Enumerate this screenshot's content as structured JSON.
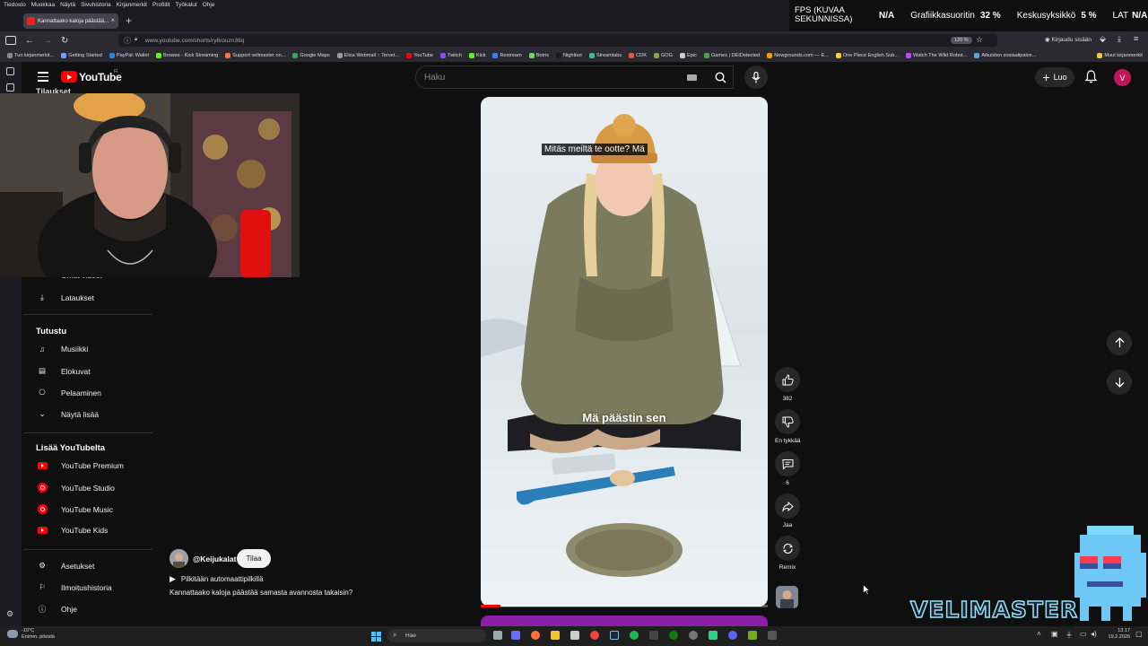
{
  "browser": {
    "menu": [
      "Tiedosto",
      "Muokkaa",
      "Näytä",
      "Sivuhistoria",
      "Kirjanmerkit",
      "Profiilit",
      "Työkalut",
      "Ohje"
    ],
    "tab_title": "Kannattaako kaloja päästää...",
    "url": "www.youtube.com/shorts/ry6rouzn36q",
    "zoom": "120 %",
    "signin": "Kirjaudu sisään",
    "bookmarks": [
      "Tuo kirjanmerkit...",
      "Getting Started",
      "PayPal: Wallet",
      "Browse - Kick Streaming",
      "Support velimaster on...",
      "Google Maps",
      "Elisa Webmail :: Tervet...",
      "YouTube",
      "Twitch",
      "Kick",
      "Restream",
      "Botrix",
      "Nightbot",
      "Streamlabs",
      "CDK",
      "GOG",
      "Epic",
      "Games | DEIDetected",
      "Newgrounds.com — E...",
      "One Piece English Sub...",
      "Watch The Wild Robot...",
      "Aikuisten sosiaalipalve...",
      "Muut kirjanmerkit"
    ]
  },
  "perf": {
    "fps_label": "FPS (KUVAA SEKUNNISSA)",
    "fps_value": "N/A",
    "gpu_label": "Grafiikkasuoritin",
    "gpu_value": "32 %",
    "cpu_label": "Keskusyksikkö",
    "cpu_value": "5 %",
    "lat_label": "LAT",
    "lat_value": "N/A"
  },
  "header": {
    "logo_text": "YouTube",
    "country": "FI",
    "search_placeholder": "Haku",
    "create_label": "Luo",
    "avatar_letter": "V"
  },
  "sidebar": {
    "hidden_top": "Tilaukset",
    "partial_item": "Omat videot",
    "downloads": "Lataukset",
    "explore_title": "Tutustu",
    "explore": [
      "Musiikki",
      "Elokuvat",
      "Pelaaminen",
      "Näytä lisää"
    ],
    "more_title": "Lisää YouTubelta",
    "more": [
      "YouTube Premium",
      "YouTube Studio",
      "YouTube Music",
      "YouTube Kids"
    ],
    "bottom": [
      "Asetukset",
      "Ilmoitushistoria",
      "Ohje"
    ]
  },
  "short": {
    "caption_top": "Mitäs meiltä te ootte? Mä",
    "caption_mid": "Mä päästin sen",
    "progress": 0.07,
    "channel": "@Keijukalat",
    "subscribe": "Tilaa",
    "sound": "Pilkitään automaattipilkillä",
    "title": "Kannattaako kaloja päästää samasta avannosta takaisin?",
    "likes": "382",
    "dislike_label": "En tykkää",
    "comments": "6",
    "share_label": "Jaa",
    "remix_label": "Remix"
  },
  "overlay": {
    "brand": "VELIMASTER"
  },
  "taskbar": {
    "weather_temp": "-10°C",
    "weather_desc": "Enimm. pilvistä",
    "search": "Hae",
    "time": "13.17",
    "date": "19.2.2026"
  },
  "colors": {
    "bg": "#0f0f0f",
    "accent": "#ff0000",
    "surface": "#272727"
  }
}
